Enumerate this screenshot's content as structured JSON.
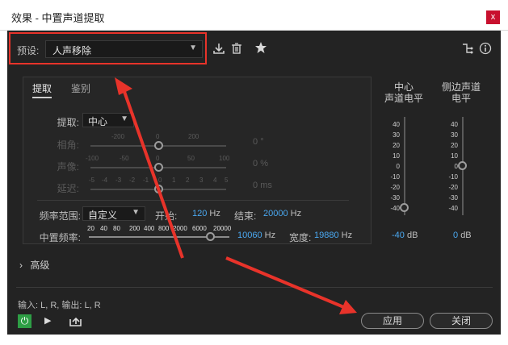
{
  "window": {
    "title": "效果 - 中置声道提取",
    "close_label": "x"
  },
  "preset": {
    "label": "预设:",
    "value": "人声移除"
  },
  "toolbar_icons": [
    "save-preset-icon",
    "trash-icon",
    "star-icon",
    "routing-icon",
    "info-icon"
  ],
  "tabs": [
    {
      "label": "提取",
      "active": true
    },
    {
      "label": "鉴别",
      "active": false
    }
  ],
  "extract": {
    "label": "提取:",
    "value": "中心"
  },
  "rows": {
    "phase": {
      "label": "相角:",
      "scale": [
        "-200",
        "0",
        "200"
      ],
      "value": "0",
      "unit": "°",
      "level": 0.5
    },
    "pan": {
      "label": "声像:",
      "scale": [
        "-100",
        "-50",
        "0",
        "50",
        "100"
      ],
      "value": "0",
      "unit": "%",
      "level": 0.5
    },
    "delay": {
      "label": "延迟:",
      "scale": [
        "-5",
        "-4",
        "-3",
        "-2",
        "-1",
        "0",
        "1",
        "2",
        "3",
        "4",
        "5"
      ],
      "value": "0",
      "unit": "ms",
      "level": 0.5
    }
  },
  "freq_range": {
    "label": "频率范围:",
    "value": "自定义",
    "start_label": "开始:",
    "start_value": "120",
    "start_unit": "Hz",
    "end_label": "结束:",
    "end_value": "20000",
    "end_unit": "Hz"
  },
  "center_freq": {
    "label": "中置频率:",
    "scale": [
      "20",
      "40",
      "80",
      "200",
      "400",
      "800",
      "2000",
      "6000",
      "20000"
    ],
    "value": "10060",
    "unit": "Hz",
    "width_label": "宽度:",
    "width_value": "19880",
    "width_unit": "Hz",
    "level": 0.95
  },
  "meters": {
    "center": {
      "title_line1": "中心",
      "title_line2": "声道电平",
      "value": "-40",
      "unit": "dB",
      "level": 0.0
    },
    "side": {
      "title_line1": "侧边声道",
      "title_line2": "电平",
      "value": "0",
      "unit": "dB",
      "level": 0.5
    },
    "scale": [
      "40",
      "30",
      "20",
      "10",
      "0",
      "-10",
      "-20",
      "-30",
      "-40"
    ]
  },
  "advanced_label": "高级",
  "io_text": "输入: L, R,  输出: L, R",
  "buttons": {
    "apply": "应用",
    "close": "关闭"
  },
  "colors": {
    "background": "#232323",
    "accent_blue": "#4aa8f0",
    "highlight_red": "#e8332a",
    "power_green": "#2e9e45",
    "close_red": "#c8102e"
  }
}
